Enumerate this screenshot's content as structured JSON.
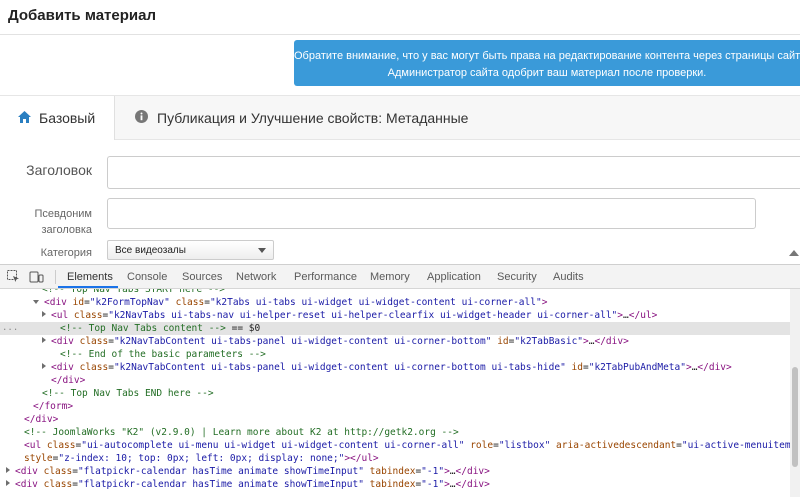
{
  "page": {
    "title": "Добавить материал",
    "notice_line1": "Обратите внимание, что у вас могут быть права на редактирование контента через страницы сайта, но вы не имеете",
    "notice_line2": "Администратор сайта одобрит ваш материал после проверки."
  },
  "tabs": {
    "basic": {
      "icon": "home-icon",
      "label": "Базовый"
    },
    "publishing": {
      "icon": "info-icon",
      "label": "Публикация и Улучшение свойств: Метаданные"
    }
  },
  "form": {
    "title_label": "Заголовок",
    "alias_label": "Псевдоним заголовка",
    "category_label": "Категория",
    "category_selected": "Все видеозалы"
  },
  "devtools": {
    "tabs": [
      "Elements",
      "Console",
      "Sources",
      "Network",
      "Performance",
      "Memory",
      "Application",
      "Security",
      "Audits"
    ],
    "active_tab": "Elements",
    "selected_marker": "...",
    "lines": [
      {
        "indent": 3,
        "tri": "none",
        "segs": [
          [
            "com",
            "<!-- Top Nav Tabs START here -->"
          ]
        ]
      },
      {
        "indent": 3,
        "tri": "open",
        "segs": [
          [
            "tag",
            "<div "
          ],
          [
            "attr",
            "id"
          ],
          [
            "plain",
            "="
          ],
          [
            "val",
            "\"k2FormTopNav\""
          ],
          [
            "plain",
            " "
          ],
          [
            "attr",
            "class"
          ],
          [
            "plain",
            "="
          ],
          [
            "val",
            "\"k2Tabs ui-tabs ui-widget ui-widget-content ui-corner-all\""
          ],
          [
            "tag",
            ">"
          ]
        ]
      },
      {
        "indent": 4,
        "tri": "closed",
        "segs": [
          [
            "tag",
            "<ul "
          ],
          [
            "attr",
            "class"
          ],
          [
            "plain",
            "="
          ],
          [
            "val",
            "\"k2NavTabs ui-tabs-nav ui-helper-reset ui-helper-clearfix ui-widget-header ui-corner-all\""
          ],
          [
            "tag",
            ">"
          ],
          [
            "plain",
            "…"
          ],
          [
            "tag",
            "</ul>"
          ]
        ]
      },
      {
        "indent": 5,
        "tri": "none",
        "sel": true,
        "segs": [
          [
            "com",
            "<!-- Top Nav Tabs content -->"
          ],
          [
            "plain",
            " == $0"
          ]
        ]
      },
      {
        "indent": 4,
        "tri": "closed",
        "segs": [
          [
            "tag",
            "<div "
          ],
          [
            "attr",
            "class"
          ],
          [
            "plain",
            "="
          ],
          [
            "val",
            "\"k2NavTabContent ui-tabs-panel ui-widget-content ui-corner-bottom\""
          ],
          [
            "plain",
            " "
          ],
          [
            "attr",
            "id"
          ],
          [
            "plain",
            "="
          ],
          [
            "val",
            "\"k2TabBasic\""
          ],
          [
            "tag",
            ">"
          ],
          [
            "plain",
            "…"
          ],
          [
            "tag",
            "</div>"
          ]
        ]
      },
      {
        "indent": 5,
        "tri": "none",
        "segs": [
          [
            "com",
            "<!-- End of the basic parameters -->"
          ]
        ]
      },
      {
        "indent": 4,
        "tri": "closed",
        "segs": [
          [
            "tag",
            "<div "
          ],
          [
            "attr",
            "class"
          ],
          [
            "plain",
            "="
          ],
          [
            "val",
            "\"k2NavTabContent ui-tabs-panel ui-widget-content ui-corner-bottom ui-tabs-hide\""
          ],
          [
            "plain",
            " "
          ],
          [
            "attr",
            "id"
          ],
          [
            "plain",
            "="
          ],
          [
            "val",
            "\"k2TabPubAndMeta\""
          ],
          [
            "tag",
            ">"
          ],
          [
            "plain",
            "…"
          ],
          [
            "tag",
            "</div>"
          ]
        ]
      },
      {
        "indent": 4,
        "tri": "none",
        "segs": [
          [
            "tag",
            "</div>"
          ]
        ]
      },
      {
        "indent": 3,
        "tri": "none",
        "segs": [
          [
            "com",
            "<!-- Top Nav Tabs END here -->"
          ]
        ]
      },
      {
        "indent": 2,
        "tri": "none",
        "segs": [
          [
            "tag",
            "</form>"
          ]
        ]
      },
      {
        "indent": 1,
        "tri": "none",
        "segs": [
          [
            "tag",
            "</div>"
          ]
        ]
      },
      {
        "indent": 1,
        "tri": "none",
        "segs": [
          [
            "com",
            "<!-- JoomlaWorks \"K2\" (v2.9.0) | Learn more about K2 at http://getk2.org -->"
          ]
        ]
      },
      {
        "indent": 1,
        "tri": "none",
        "segs": [
          [
            "tag",
            "<ul "
          ],
          [
            "attr",
            "class"
          ],
          [
            "plain",
            "="
          ],
          [
            "val",
            "\"ui-autocomplete ui-menu ui-widget ui-widget-content ui-corner-all\""
          ],
          [
            "plain",
            " "
          ],
          [
            "attr",
            "role"
          ],
          [
            "plain",
            "="
          ],
          [
            "val",
            "\"listbox\""
          ],
          [
            "plain",
            " "
          ],
          [
            "attr",
            "aria-activedescendant"
          ],
          [
            "plain",
            "="
          ],
          [
            "val",
            "\"ui-active-menuitem\""
          ]
        ]
      },
      {
        "indent": 1,
        "tri": "none",
        "segs": [
          [
            "attr",
            "style"
          ],
          [
            "plain",
            "="
          ],
          [
            "val",
            "\"z-index: 10; top: 0px; left: 0px; display: none;\""
          ],
          [
            "tag",
            "></ul>"
          ]
        ]
      },
      {
        "indent": 0,
        "tri": "closed",
        "segs": [
          [
            "tag",
            "<div "
          ],
          [
            "attr",
            "class"
          ],
          [
            "plain",
            "="
          ],
          [
            "val",
            "\"flatpickr-calendar hasTime animate showTimeInput\""
          ],
          [
            "plain",
            " "
          ],
          [
            "attr",
            "tabindex"
          ],
          [
            "plain",
            "="
          ],
          [
            "val",
            "\"-1\""
          ],
          [
            "tag",
            ">"
          ],
          [
            "plain",
            "…"
          ],
          [
            "tag",
            "</div>"
          ]
        ]
      },
      {
        "indent": 0,
        "tri": "closed",
        "segs": [
          [
            "tag",
            "<div "
          ],
          [
            "attr",
            "class"
          ],
          [
            "plain",
            "="
          ],
          [
            "val",
            "\"flatpickr-calendar hasTime animate showTimeInput\""
          ],
          [
            "plain",
            " "
          ],
          [
            "attr",
            "tabindex"
          ],
          [
            "plain",
            "="
          ],
          [
            "val",
            "\"-1\""
          ],
          [
            "tag",
            ">"
          ],
          [
            "plain",
            "…"
          ],
          [
            "tag",
            "</div>"
          ]
        ]
      }
    ]
  }
}
